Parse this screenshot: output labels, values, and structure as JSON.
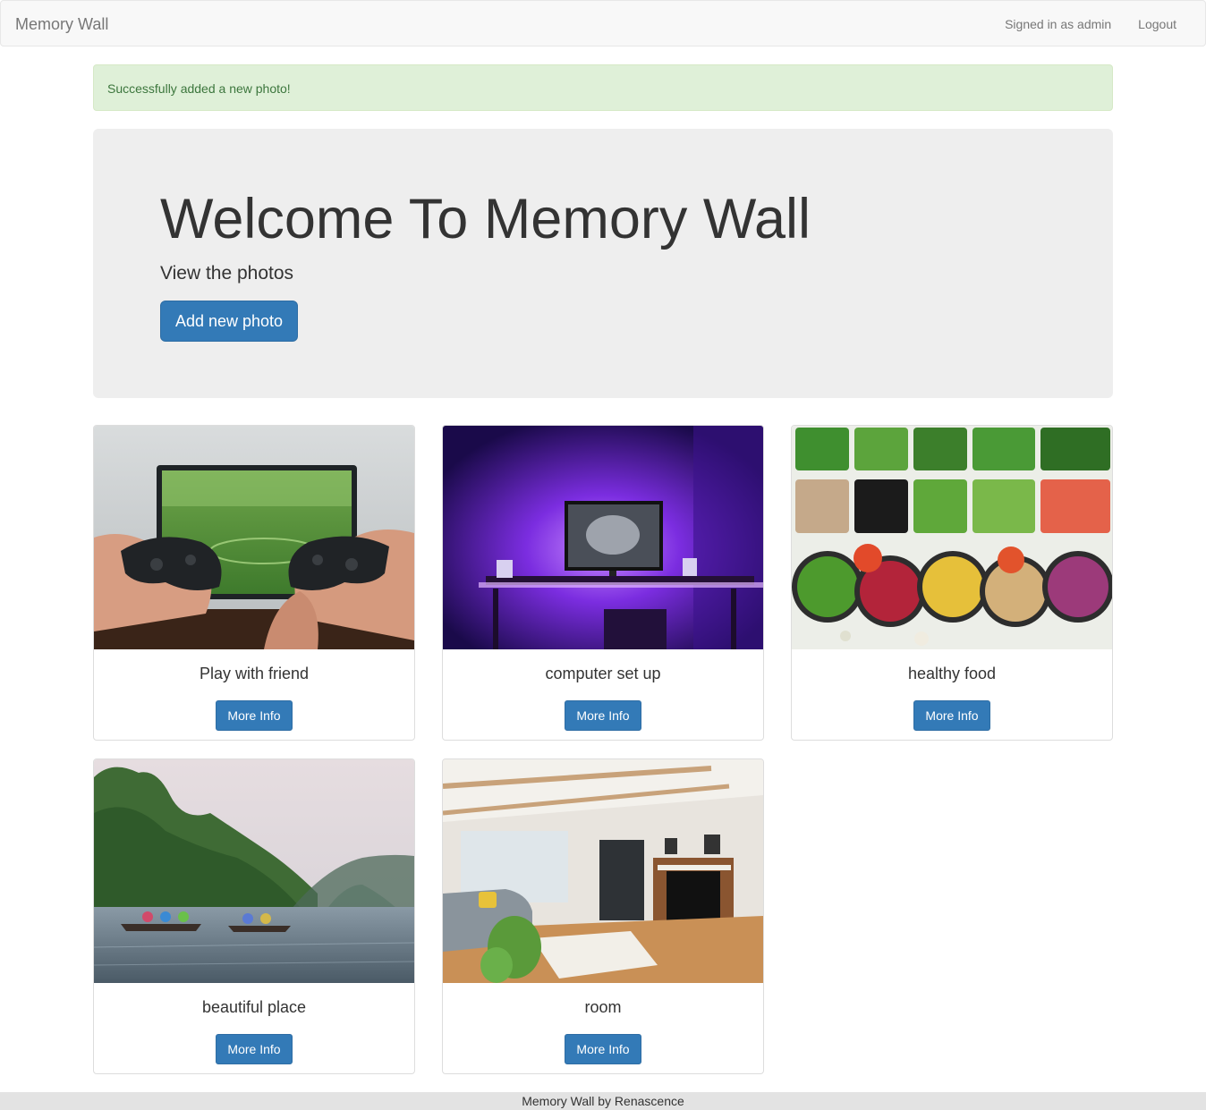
{
  "navbar": {
    "brand": "Memory Wall",
    "signed_in": "Signed in as admin",
    "logout": "Logout"
  },
  "alert": {
    "message": "Successfully added a new photo!",
    "color": "#dff0d8"
  },
  "jumbotron": {
    "title": "Welcome To Memory Wall",
    "subtitle": "View the photos",
    "button_label": "Add new photo"
  },
  "photos": [
    {
      "title": "Play with friend",
      "button_label": "More Info",
      "image": "gaming-controllers-photo"
    },
    {
      "title": "computer set up",
      "button_label": "More Info",
      "image": "purple-desk-setup-photo"
    },
    {
      "title": "healthy food",
      "button_label": "More Info",
      "image": "salad-bar-photo"
    },
    {
      "title": "beautiful place",
      "button_label": "More Info",
      "image": "river-boats-photo"
    },
    {
      "title": "room",
      "button_label": "More Info",
      "image": "living-room-photo"
    }
  ],
  "footer": {
    "text": "Memory Wall by Renascence"
  },
  "colors": {
    "primary": "#337ab7",
    "navbar_bg": "#f8f8f8",
    "jumbotron_bg": "#eeeeee",
    "footer_bg": "#e3e3e3"
  }
}
